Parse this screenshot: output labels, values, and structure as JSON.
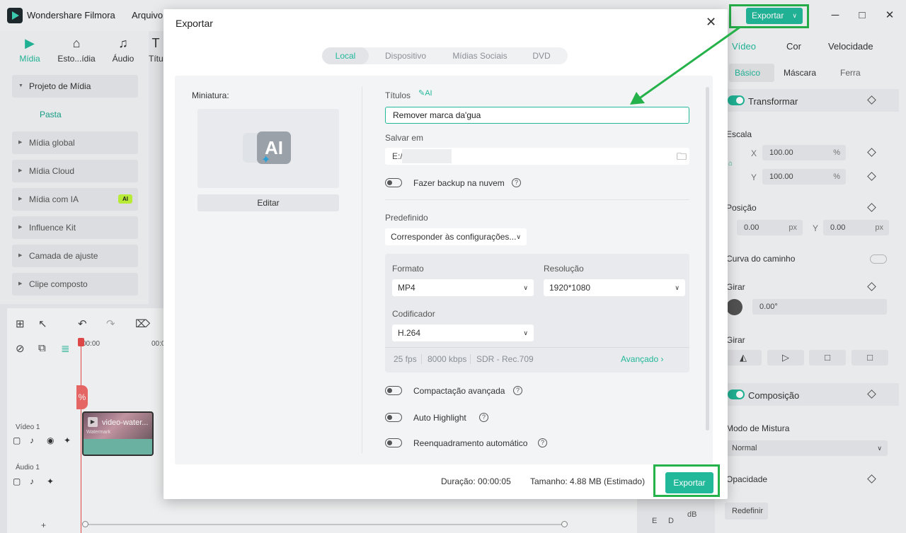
{
  "app": {
    "title": "Wondershare Filmora",
    "menu_arquivo": "Arquivo",
    "export_label": "Exportar"
  },
  "left_tabs": [
    {
      "label": "Mídia",
      "icon": "media-icon"
    },
    {
      "label": "Esto...ídia",
      "icon": "stock-media-icon"
    },
    {
      "label": "Áudio",
      "icon": "audio-icon"
    },
    {
      "label": "Títu",
      "icon": "title-icon"
    }
  ],
  "media_tree": {
    "project": "Projeto de Mídia",
    "pasta": "Pasta",
    "items": [
      "Mídia global",
      "Mídia Cloud",
      "Mídia com IA",
      "Influence Kit",
      "Camada de ajuste",
      "Clipe composto"
    ],
    "ai_badge": "AI"
  },
  "timeline": {
    "time_start": "00:00",
    "time_next": "00:0",
    "clip_name": "video-water...",
    "clip_watermark": "Watermark",
    "video_track": "Vídeo 1",
    "audio_track": "Áudio 1",
    "clip_marker": "%",
    "add": "+",
    "meter_db": "dB",
    "meter_e": "E",
    "meter_d": "D"
  },
  "right_panel": {
    "tabs": [
      "Vídeo",
      "Cor",
      "Velocidade"
    ],
    "subtabs": [
      "Básico",
      "Máscara",
      "Ferra"
    ],
    "transform": "Transformar",
    "scale": "Escala",
    "scale_x": "100.00",
    "scale_y": "100.00",
    "percent": "%",
    "x": "X",
    "y": "Y",
    "position": "Posição",
    "pos_x": "0.00",
    "pos_y": "0.00",
    "px": "px",
    "path_curve": "Curva do caminho",
    "rotate": "Girar",
    "rotate_value": "0.00°",
    "flip": "Girar",
    "composition": "Composição",
    "blend_mode": "Modo de Mistura",
    "blend_value": "Normal",
    "opacity": "Opacidade",
    "reset": "Redefinir"
  },
  "dialog": {
    "title": "Exportar",
    "tabs": [
      "Local",
      "Dispositivo",
      "Mídias Sociais",
      "DVD"
    ],
    "thumbnail_label": "Miniatura:",
    "thumbnail_badge": "AI",
    "edit_button": "Editar",
    "titles_label": "Títulos",
    "titles_ai": "AI",
    "title_value": "Remover marca da'gua",
    "save_label": "Salvar em",
    "save_path": "E:/",
    "backup_label": "Fazer backup na nuvem",
    "preset_label": "Predefinido",
    "preset_value": "Corresponder às configurações...",
    "format_label": "Formato",
    "format_value": "MP4",
    "resolution_label": "Resolução",
    "resolution_value": "1920*1080",
    "encoder_label": "Codificador",
    "encoder_value": "H.264",
    "fps": "25 fps",
    "bitrate": "8000 kbps",
    "color": "SDR - Rec.709",
    "advanced": "Avançado",
    "adv_compress": "Compactação avançada",
    "auto_highlight": "Auto Highlight",
    "auto_reframe": "Reenquadramento automático",
    "duration": "Duração: 00:00:05",
    "size": "Tamanho: 4.88 MB (Estimado)",
    "export_button": "Exportar"
  },
  "colors": {
    "accent": "#22b89a",
    "highlight": "#26b24a"
  }
}
